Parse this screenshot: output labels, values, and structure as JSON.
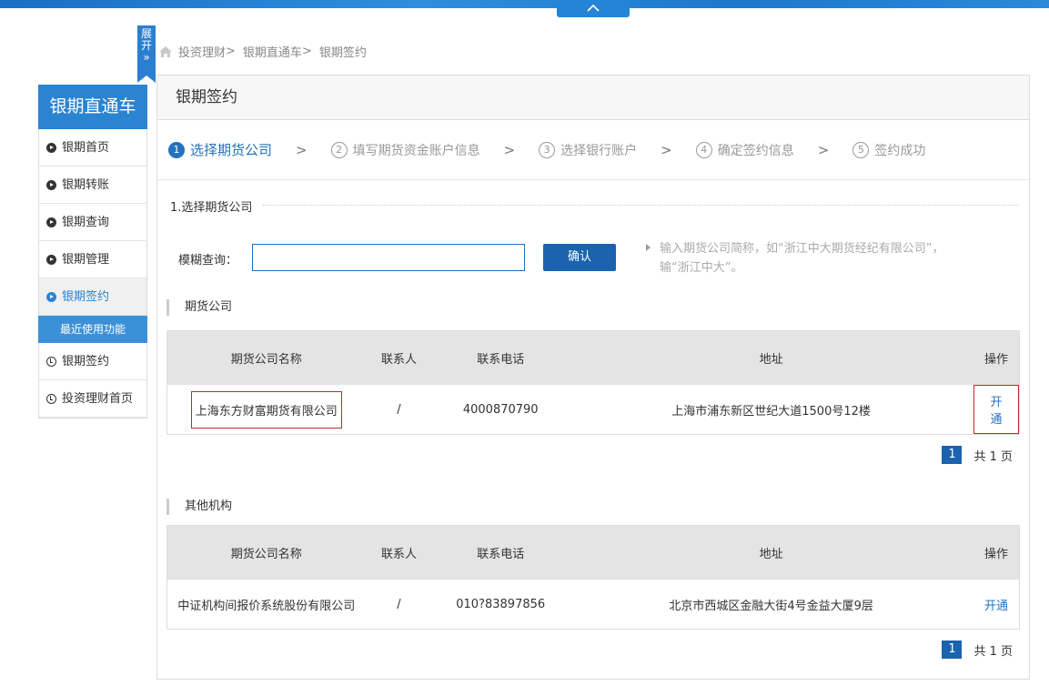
{
  "topbar": {
    "collapse_icon": "chevron-up-icon"
  },
  "expand_tab": {
    "label_line1": "展",
    "label_line2": "开",
    "icon": "double-chevron-right-icon"
  },
  "breadcrumb": {
    "home_icon": "home-icon",
    "items": [
      "投资理财",
      "银期直通车",
      "银期签约"
    ],
    "separator": ">"
  },
  "sidebar": {
    "title": "银期直通车",
    "items": [
      {
        "label": "银期首页",
        "active": false
      },
      {
        "label": "银期转账",
        "active": false
      },
      {
        "label": "银期查询",
        "active": false
      },
      {
        "label": "银期管理",
        "active": false
      },
      {
        "label": "银期签约",
        "active": true
      }
    ],
    "recent_title": "最近使用功能",
    "recent_items": [
      {
        "label": "银期签约"
      },
      {
        "label": "投资理财首页"
      }
    ]
  },
  "main": {
    "title": "银期签约",
    "steps": [
      {
        "num": "1",
        "label": "选择期货公司"
      },
      {
        "num": "2",
        "label": "填写期货资金账户信息"
      },
      {
        "num": "3",
        "label": "选择银行账户"
      },
      {
        "num": "4",
        "label": "确定签约信息"
      },
      {
        "num": "5",
        "label": "签约成功"
      }
    ],
    "step_arrow": ">",
    "section_title": "1.选择期货公司",
    "search": {
      "label": "模糊查询：",
      "value": "",
      "confirm_label": "确认",
      "hint": "输入期货公司简称，如“浙江中大期货经纪有限公司”，输“浙江中大”。"
    },
    "futures": {
      "title": "期货公司",
      "headers": [
        "期货公司名称",
        "联系人",
        "联系电话",
        "地址",
        "操作"
      ],
      "rows": [
        {
          "name": "上海东方财富期货有限公司",
          "contact": "/",
          "phone": "4000870790",
          "address": "上海市浦东新区世纪大道1500号12楼",
          "action": "开通"
        }
      ],
      "pager": {
        "page": "1",
        "total": "共 1 页"
      }
    },
    "others": {
      "title": "其他机构",
      "headers": [
        "期货公司名称",
        "联系人",
        "联系电话",
        "地址",
        "操作"
      ],
      "rows": [
        {
          "name": "中证机构间报价系统股份有限公司",
          "contact": "/",
          "phone": "010?83897856",
          "address": "北京市西城区金融大街4号金益大厦9层",
          "action": "开通"
        }
      ],
      "pager": {
        "page": "1",
        "total": "共 1 页"
      }
    }
  },
  "colors": {
    "primary": "#2472c0",
    "sidebar_title": "#2a84d2",
    "button": "#1a63ae",
    "highlight_border": "#c9252c"
  }
}
